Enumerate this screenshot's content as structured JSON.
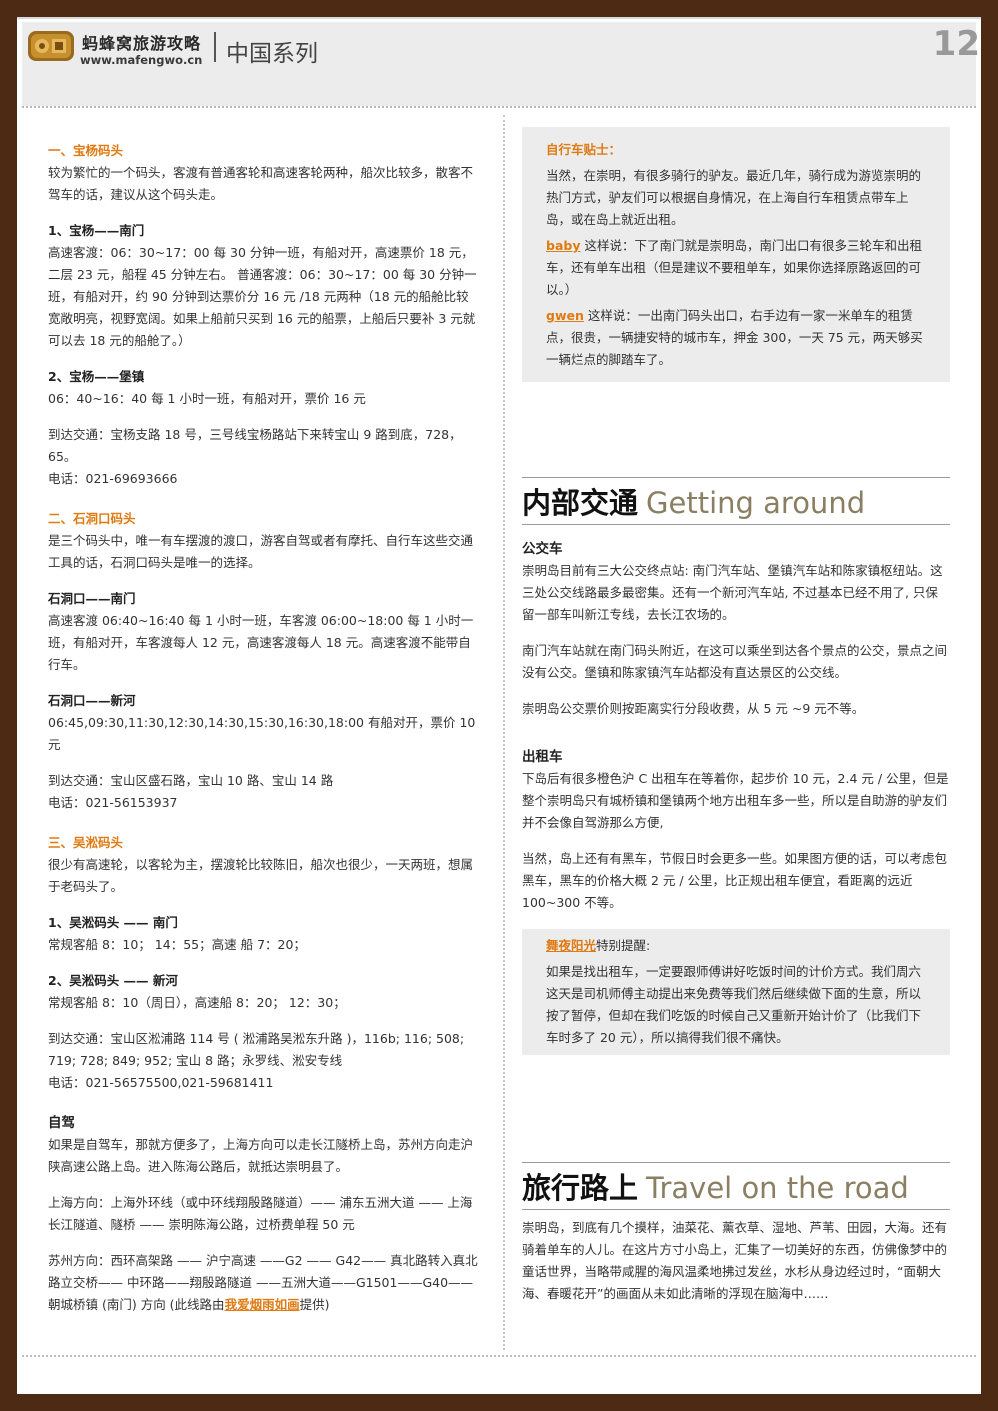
{
  "header": {
    "brand_cn": "蚂蜂窝旅游攻略",
    "brand_url": "www.mafengwo.cn",
    "series": "中国系列",
    "page_number": "12"
  },
  "left": {
    "s1_title": "一、宝杨码头",
    "s1_p1": "较为繁忙的一个码头，客渡有普通客轮和高速客轮两种，船次比较多，散客不驾车的话，建议从这个码头走。",
    "s1_r1_title": "1、宝杨——南门",
    "s1_r1_body": "高速客渡：06：30~17：00 每 30 分钟一班，有船对开，高速票价 18 元，二层 23 元，船程 45 分钟左右。 普通客渡：06：30~17：00 每 30 分钟一班，有船对开，约 90 分钟到达票价分 16 元 /18 元两种（18 元的船舱比较宽敞明亮，视野宽阔。如果上船前只买到 16 元的船票，上船后只要补 3 元就可以去 18 元的船舱了。）",
    "s1_r2_title": "2、宝杨——堡镇",
    "s1_r2_body": "06：40~16：40 每 1 小时一班，有船对开，票价 16 元",
    "s1_traffic": "到达交通：宝杨支路 18 号，三号线宝杨路站下来转宝山 9 路到底，728，65。",
    "s1_phone": "电话：021-69693666",
    "s2_title": "二、石洞口码头",
    "s2_p1": "是三个码头中，唯一有车摆渡的渡口，游客自驾或者有摩托、自行车这些交通工具的话，石洞口码头是唯一的选择。",
    "s2_r1_title": "石洞口——南门",
    "s2_r1_body": "高速客渡 06:40~16:40 每 1 小时一班，车客渡 06:00~18:00 每 1 小时一班，有船对开，车客渡每人 12 元，高速客渡每人 18 元。高速客渡不能带自行车。",
    "s2_r2_title": "石洞口——新河",
    "s2_r2_body": "06:45,09:30,11:30,12:30,14:30,15:30,16:30,18:00 有船对开，票价 10 元",
    "s2_traffic": "到达交通：宝山区盛石路，宝山 10 路、宝山 14 路",
    "s2_phone": "电话：021-56153937",
    "s3_title": "三、吴淞码头",
    "s3_p1": "很少有高速轮，以客轮为主，摆渡轮比较陈旧，船次也很少，一天两班，想属于老码头了。",
    "s3_r1_title": "1、吴淞码头 —— 南门",
    "s3_r1_body": "常规客船 8：10； 14：55；高速 船 7：20；",
    "s3_r2_title": "2、吴淞码头 —— 新河",
    "s3_r2_body": "常规客船 8：10（周日），高速船 8：20； 12：30；",
    "s3_traffic": "到达交通：宝山区淞浦路 114 号 ( 淞浦路吴淞东升路 )，116b; 116; 508; 719; 728; 849; 952; 宝山 8 路；永罗线、淞安专线",
    "s3_phone": "电话：021-56575500,021-59681411",
    "drive_title": "自驾",
    "drive_p1": "如果是自驾车，那就方便多了，上海方向可以走长江隧桥上岛，苏州方向走沪陕高速公路上岛。进入陈海公路后，就抵达崇明县了。",
    "drive_sh": "上海方向：上海外环线（或中环线翔殷路隧道）—— 浦东五洲大道 —— 上海长江隧道、隧桥 —— 崇明陈海公路，过桥费单程 50 元",
    "drive_sz": "苏州方向：西环高架路 —— 沪宁高速 ——G2 —— G42—— 真北路转入真北路立交桥—— 中环路——翔殷路隧道 ——五洲大道——G1501——G40——朝城桥镇 (南门) 方向 (此线路由",
    "drive_sz_user": "我爱烟雨如画",
    "drive_sz_end": "提供)"
  },
  "tip": {
    "title": "自行车贴士：",
    "p1": "当然，在崇明，有很多骑行的驴友。最近几年，骑行成为游览崇明的热门方式，驴友们可以根据自身情况，在上海自行车租赁点带车上岛，或在岛上就近出租。",
    "u1": "baby",
    "p2": " 这样说：下了南门就是崇明岛，南门出口有很多三轮车和出租车，还有单车出租（但是建议不要租单车，如果你选择原路返回的可以。）",
    "u2": "gwen",
    "p3": " 这样说：一出南门码头出口，右手边有一家一米单车的租赁点，很贵，一辆捷安特的城市车，押金 300，一天 75 元，两天够买一辆烂点的脚踏车了。"
  },
  "internal": {
    "title_cn": "内部交通",
    "title_en": "Getting around",
    "bus_title": "公交车",
    "bus_p1": "崇明岛目前有三大公交终点站: 南门汽车站、堡镇汽车站和陈家镇枢纽站。这三处公交线路最多最密集。还有一个新河汽车站, 不过基本已经不用了, 只保留一部车叫新江专线，去长江农场的。",
    "bus_p2": "南门汽车站就在南门码头附近，在这可以乘坐到达各个景点的公交，景点之间没有公交。堡镇和陈家镇汽车站都没有直达景区的公交线。",
    "bus_p3": "崇明岛公交票价则按距离实行分段收费，从 5 元 ~9 元不等。",
    "taxi_title": "出租车",
    "taxi_p1": "下岛后有很多橙色沪 C 出租车在等着你，起步价 10 元，2.4 元 / 公里，但是整个崇明岛只有城桥镇和堡镇两个地方出租车多一些，所以是自助游的驴友们并不会像自驾游那么方便,",
    "taxi_p2": "当然，岛上还有有黑车，节假日时会更多一些。如果图方便的话，可以考虑包黑车，黑车的价格大概 2 元 / 公里，比正规出租车便宜，看距离的远近 100~300 不等。"
  },
  "tip2": {
    "user": "舞夜阳光",
    "title_rest": "特别提醒:",
    "body": "如果是找出租车，一定要跟师傅讲好吃饭时间的计价方式。我们周六这天是司机师傅主动提出来免费等我们然后继续做下面的生意，所以按了暂停，但却在我们吃饭的时候自己又重新开始计价了（比我们下车时多了 20 元），所以搞得我们很不痛快。"
  },
  "travel": {
    "title_cn": "旅行路上",
    "title_en": "Travel on the road",
    "p1": "崇明岛，到底有几个摸样，油菜花、薰衣草、湿地、芦苇、田园，大海。还有骑着单车的人儿。在这片方寸小岛上，汇集了一切美好的东西，仿佛像梦中的童话世界，当略带咸腥的海风温柔地拂过发丝，水杉从身边经过时，“面朝大海、春暖花开”的画面从未如此清晰的浮现在脑海中……"
  }
}
